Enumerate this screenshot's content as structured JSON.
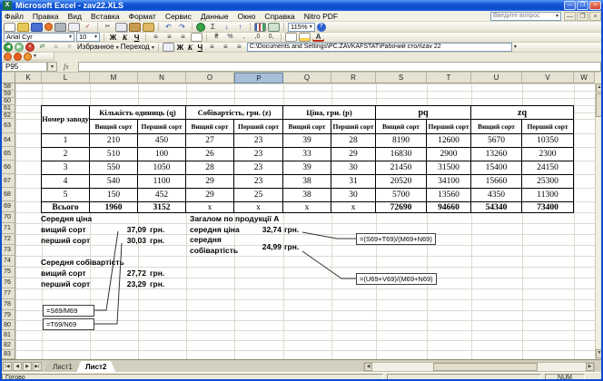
{
  "window": {
    "title": "Microsoft Excel - zav22.XLS",
    "controls": {
      "minimize": "—",
      "maximize": "❐",
      "close": "×"
    }
  },
  "menubar": {
    "items": [
      "Файл",
      "Правка",
      "Вид",
      "Вставка",
      "Формат",
      "Сервис",
      "Данные",
      "Окно",
      "Справка",
      "Nitro PDF"
    ],
    "question_box": "Введите вопрос",
    "doc_controls": {
      "minimize": "—",
      "restore": "❐",
      "close": "×"
    }
  },
  "icons": {
    "dropdown_glyph": "▾",
    "autosum_glyph": "Σ",
    "cut_glyph": "✂",
    "undo_glyph": "↶",
    "redo_glyph": "↷",
    "sort_asc_glyph": "↓",
    "sort_desc_glyph": "↑",
    "back_glyph": "◀",
    "forward_glyph": "▶",
    "stop_glyph": "×",
    "refresh_glyph": "⇄",
    "home_glyph": "⌂",
    "search_glyph": "○",
    "help_glyph": "?",
    "align_glyph": "≡",
    "check_glyph": "✓",
    "percent_glyph": "%",
    "font_color_glyph": "А"
  },
  "standard_toolbar": {
    "zoom_value": "115%"
  },
  "formatting_toolbar": {
    "font_name": "Arial Cyr",
    "font_size": "10",
    "bold": "Ж",
    "italic": "К",
    "underline": "Ч"
  },
  "web_toolbar": {
    "favorites_label": "Избранное",
    "go_label": "Переход",
    "address": "C:\\Documents and Settings\\PC.ZAVKAFSTAT\\Рабочий стол\\zav 22"
  },
  "formula_bar": {
    "name_box": "P95",
    "fx_label": "fx",
    "content": ""
  },
  "grid": {
    "columns": [
      "K",
      "L",
      "M",
      "N",
      "O",
      "P",
      "Q",
      "R",
      "S",
      "T",
      "U",
      "V",
      "W"
    ],
    "selected_column": "P",
    "rows": [
      "58",
      "59",
      "60",
      "61",
      "62",
      "63",
      "64",
      "65",
      "66",
      "67",
      "68",
      "69",
      "70",
      "71",
      "72",
      "73",
      "74",
      "75",
      "76",
      "77",
      "78",
      "79",
      "80",
      "81",
      "82",
      "83"
    ]
  },
  "table": {
    "row_header_title": "Номер заводу",
    "groups": [
      "Кількість одиниць (q)",
      "Собівартість, грн. (z)",
      "Ціна, грн. (р)",
      "pq",
      "zq"
    ],
    "sub_high": "Вищий сорт",
    "sub_first": "Перший сорт",
    "rows": [
      {
        "num": "1",
        "cells": [
          "210",
          "450",
          "27",
          "23",
          "39",
          "28",
          "8190",
          "12600",
          "5670",
          "10350"
        ]
      },
      {
        "num": "2",
        "cells": [
          "510",
          "100",
          "26",
          "23",
          "33",
          "29",
          "16830",
          "2900",
          "13260",
          "2300"
        ]
      },
      {
        "num": "3",
        "cells": [
          "550",
          "1050",
          "28",
          "23",
          "39",
          "30",
          "21450",
          "31500",
          "15400",
          "24150"
        ]
      },
      {
        "num": "4",
        "cells": [
          "540",
          "1100",
          "29",
          "23",
          "38",
          "31",
          "20520",
          "34100",
          "15660",
          "25300"
        ]
      },
      {
        "num": "5",
        "cells": [
          "150",
          "452",
          "29",
          "25",
          "38",
          "30",
          "5700",
          "13560",
          "4350",
          "11300"
        ]
      }
    ],
    "total": {
      "num": "Всього",
      "cells": [
        "1960",
        "3152",
        "x",
        "x",
        "x",
        "x",
        "72690",
        "94660",
        "54340",
        "73400"
      ]
    }
  },
  "analysis": {
    "left": {
      "avg_price_title": "Середня ціна",
      "high_label": "вищий сорт",
      "high_value": "37,09",
      "high_unit": "грн.",
      "first_label": "перший сорт",
      "first_value": "30,03",
      "first_unit": "грн.",
      "avg_cost_title": "Середня собівартість",
      "cost_high_label": "вищий сорт",
      "cost_high_value": "27,72",
      "cost_high_unit": "грн.",
      "cost_first_label": "перший сорт",
      "cost_first_value": "23,29",
      "cost_first_unit": "грн."
    },
    "right": {
      "title": "Загалом по продукції А",
      "avg_price_label": "середня ціна",
      "avg_price_value": "32,74",
      "avg_price_unit": "грн.",
      "avg_cost_label_line1": "середня",
      "avg_cost_label_line2": "собівартість",
      "avg_cost_value": "24,99",
      "avg_cost_unit": "грн."
    },
    "formulas": {
      "price_overall": "=(S69+T69)/(M69+N69)",
      "cost_overall": "=(U69+V69)/(M69+N69)",
      "price_high": "=S69/M69",
      "price_first": "=T69/N69"
    }
  },
  "sheet_tabs": {
    "tabs": [
      "Лист1",
      "Лист2"
    ],
    "active": "Лист2"
  },
  "status_bar": {
    "ready": "Готово",
    "num_lock": "NUM"
  }
}
